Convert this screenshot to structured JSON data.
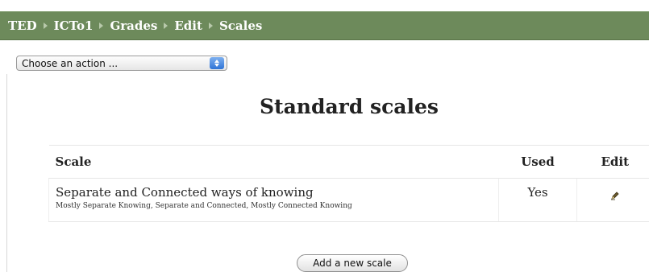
{
  "breadcrumb": {
    "items": [
      "TED",
      "ICTo1",
      "Grades",
      "Edit",
      "Scales"
    ]
  },
  "action_select": {
    "selected": "Choose an action ..."
  },
  "page_title": "Standard scales",
  "table": {
    "headers": {
      "scale": "Scale",
      "used": "Used",
      "edit": "Edit"
    },
    "rows": [
      {
        "name": "Separate and Connected ways of knowing",
        "items": "Mostly Separate Knowing, Separate and Connected, Mostly Connected Knowing",
        "used": "Yes",
        "edit_icon": "edit-icon"
      }
    ]
  },
  "add_button_label": "Add a new scale",
  "colors": {
    "navbar": "#6d8a5b",
    "navbar_text": "#ffffff"
  }
}
